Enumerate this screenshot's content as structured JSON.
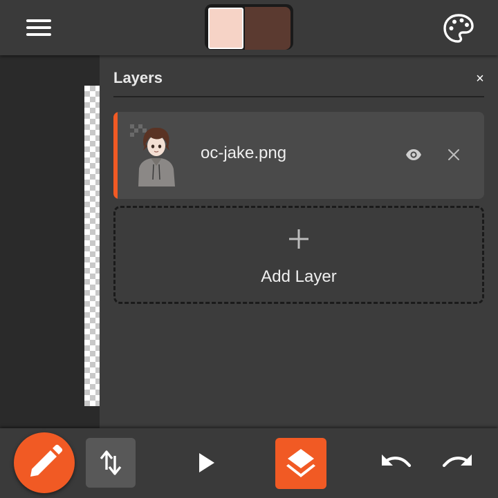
{
  "colors": {
    "accent": "#f15a24",
    "primary_swatch": "#f6d3c6",
    "secondary_swatch": "#5b3a30"
  },
  "icons": {
    "menu": "hamburger-menu-icon",
    "palette": "palette-icon",
    "visibility": "eye-icon",
    "remove": "close-icon",
    "add": "plus-icon",
    "pencil": "pencil-icon",
    "swap": "swap-vertical-icon",
    "play": "play-icon",
    "layers": "layers-icon",
    "undo": "undo-icon",
    "redo": "redo-icon"
  },
  "layers_panel": {
    "title": "Layers",
    "close_label": "×",
    "layers": [
      {
        "name": "oc-jake.png",
        "selected": true
      }
    ],
    "add_layer_label": "Add Layer"
  }
}
